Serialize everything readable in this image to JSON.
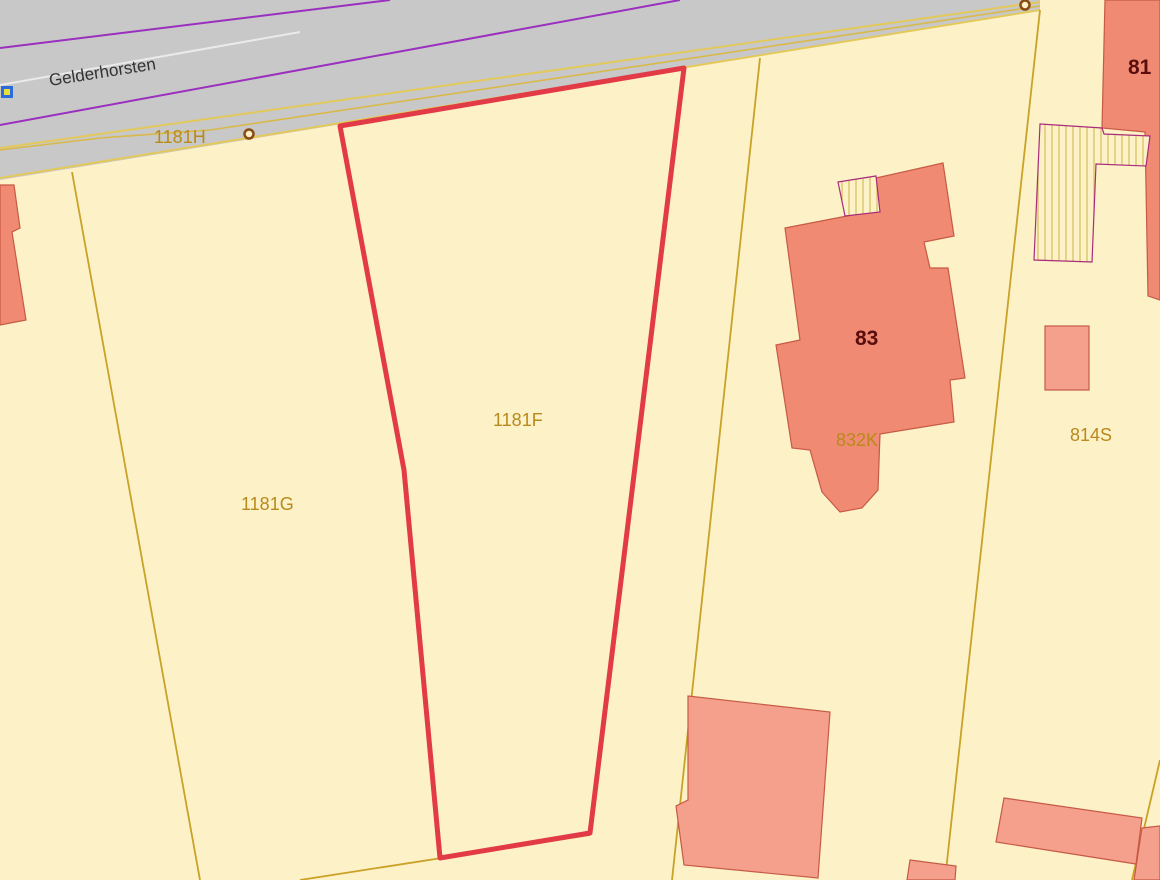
{
  "map": {
    "street": {
      "name": "Gelderhorsten"
    },
    "parcels": {
      "selected": {
        "id": "1181F"
      },
      "west": {
        "id": "1181G"
      },
      "road_strip": {
        "id": "1181H"
      },
      "east_lower": {
        "id": "832K"
      },
      "far_east": {
        "id": "814S"
      }
    },
    "house_numbers": {
      "main": "83",
      "corner": "81"
    }
  },
  "colors": {
    "parcel_fill": "#fdf1c8",
    "parcel_border": "#c9a227",
    "building_fill": "#f08a72",
    "building_border": "#c65a45",
    "outbuilding_fill": "#f5a08c",
    "road_fill": "#c8c8c8",
    "road_line": "#9b2fbf",
    "selection_outline": "#e23a46",
    "parcel_label": "#b88a1c",
    "house_label": "#5a0e0e"
  }
}
